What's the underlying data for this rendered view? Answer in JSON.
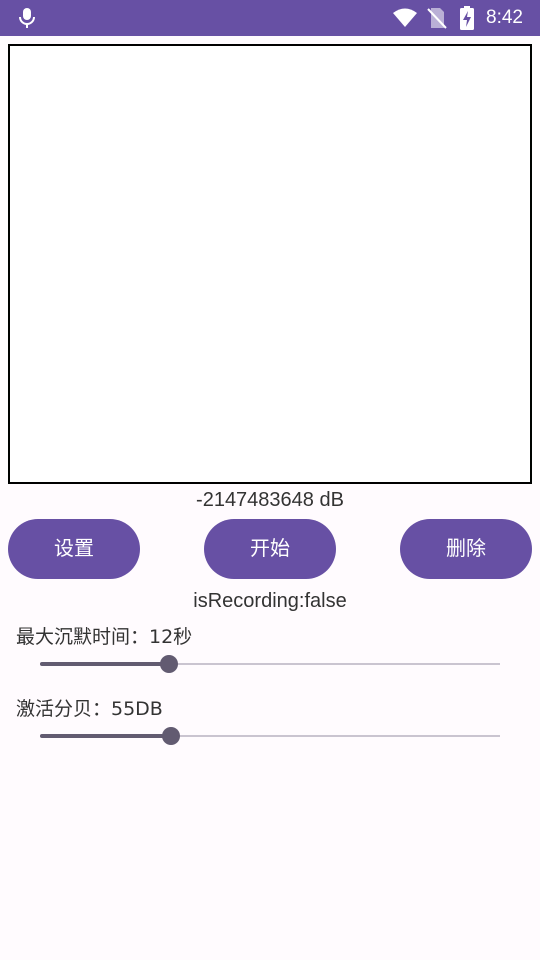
{
  "status_bar": {
    "time": "8:42",
    "icons": [
      "mic-icon",
      "wifi-icon",
      "no-sim-icon",
      "battery-charging-icon"
    ],
    "background": "#6750a4"
  },
  "waveform": {},
  "db_readout": "-2147483648 dB",
  "buttons": {
    "settings": "设置",
    "start": "开始",
    "delete": "删除",
    "color": "#6750a4"
  },
  "recording_status": "isRecording:false",
  "silence": {
    "label": "最大沉默时间：12秒",
    "slider_fraction": 0.28
  },
  "activation": {
    "label": "激活分贝：55DB",
    "slider_fraction": 0.285
  }
}
